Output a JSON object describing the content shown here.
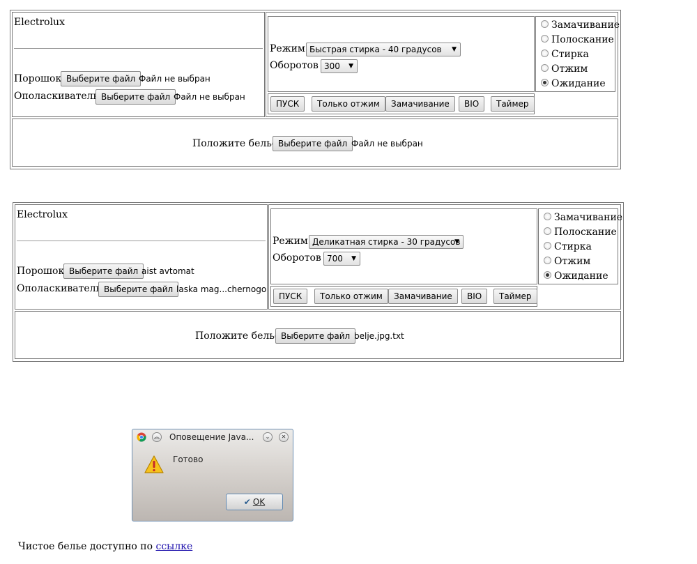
{
  "washers": [
    {
      "brand": "Electrolux",
      "powder_label": "Порошок",
      "powder_button": "Выберите файл",
      "powder_file": "Файл не выбран",
      "rinse_label": "Ополаскиватель",
      "rinse_button": "Выберите файл",
      "rinse_file": "Файл не выбран",
      "mode_label": "Режим",
      "mode_value": "Быстрая стирка - 40 градусов",
      "rpm_label": "Оборотов",
      "rpm_value": "300",
      "buttons": [
        "ПУСК",
        "Только отжим",
        "Замачивание",
        "BIO",
        "Таймер"
      ],
      "states": [
        "Замачивание",
        "Полоскание",
        "Стирка",
        "Отжим",
        "Ожидание"
      ],
      "selected_state": 4,
      "laundry_label": "Положите белье",
      "laundry_button": "Выберите файл",
      "laundry_file": "Файл не выбран"
    },
    {
      "brand": "Electrolux",
      "powder_label": "Порошок",
      "powder_button": "Выберите файл",
      "powder_file": "aist avtomat",
      "rinse_label": "Ополаскиватель",
      "rinse_button": "Выберите файл",
      "rinse_file": "laska mag...chernogo",
      "mode_label": "Режим",
      "mode_value": "Деликатная стирка - 30 градусов",
      "rpm_label": "Оборотов",
      "rpm_value": "700",
      "buttons": [
        "ПУСК",
        "Только отжим",
        "Замачивание",
        "BIO",
        "Таймер"
      ],
      "states": [
        "Замачивание",
        "Полоскание",
        "Стирка",
        "Отжим",
        "Ожидание"
      ],
      "selected_state": 4,
      "laundry_label": "Положите белье",
      "laundry_button": "Выберите файл",
      "laundry_file": "belje.jpg.txt"
    }
  ],
  "dialog": {
    "title": "Оповещение Java...",
    "message": "Готово",
    "ok_label": "OK"
  },
  "footer": {
    "text": "Чистое белье доступно по ",
    "link_text": "ссылке"
  }
}
